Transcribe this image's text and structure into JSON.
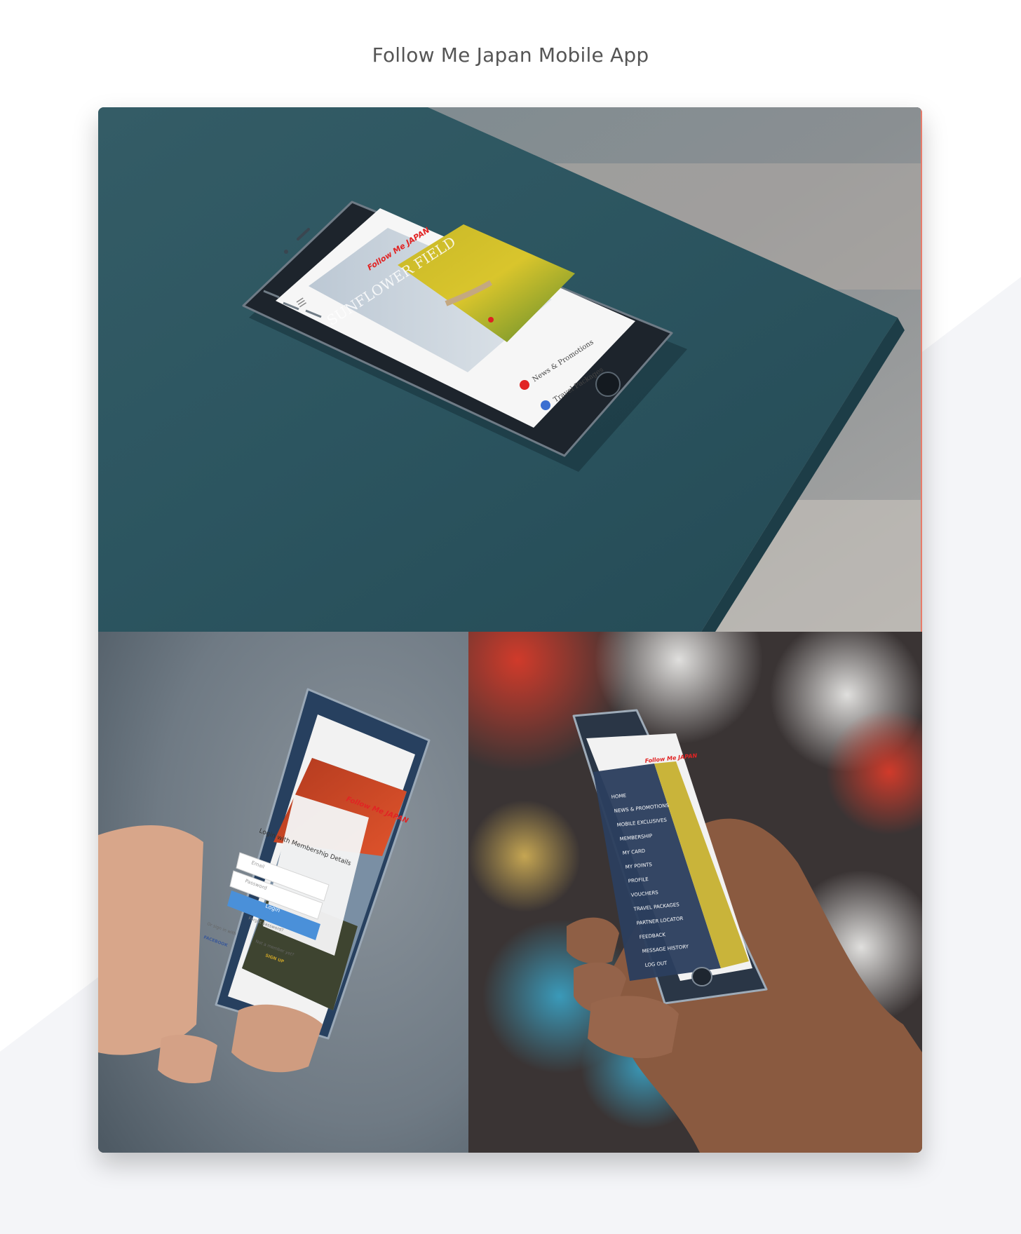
{
  "page": {
    "title": "Follow Me Japan Mobile App"
  },
  "colors": {
    "brand_red": "#e12424",
    "table_teal": "#2d5560",
    "menu_navy": "#2c3e5e",
    "login_blue": "#4a90d9",
    "signup_gold": "#c9a227"
  },
  "mockup_home": {
    "logo": "Follow Me JAPAN",
    "hero_text": "SUNFLOWER FIELD",
    "menu_icon": "hamburger-icon",
    "items": [
      {
        "label": "News & Promotions",
        "icon": "news-icon"
      },
      {
        "label": "Travel Packages",
        "icon": "travel-icon"
      }
    ]
  },
  "mockup_login": {
    "logo": "Follow Me JAPAN",
    "heading": "Login with Membership Details",
    "email_placeholder": "Email",
    "password_placeholder": "Password",
    "login_label": "Login",
    "forgot_label": "Forgot password?",
    "or_label": "Or sign in with",
    "facebook_label": "FACEBOOK",
    "not_member_label": "Not a member yet?",
    "signup_label": "SIGN UP"
  },
  "mockup_menu": {
    "logo": "Follow Me JAPAN",
    "items": [
      "HOME",
      "NEWS & PROMOTIONS",
      "MOBILE EXCLUSIVES",
      "MEMBERSHIP",
      "MY CARD",
      "MY POINTS",
      "PROFILE",
      "VOUCHERS",
      "TRAVEL PACKAGES",
      "PARTNER LOCATOR",
      "FEEDBACK",
      "MESSAGE HISTORY",
      "LOG OUT"
    ]
  }
}
